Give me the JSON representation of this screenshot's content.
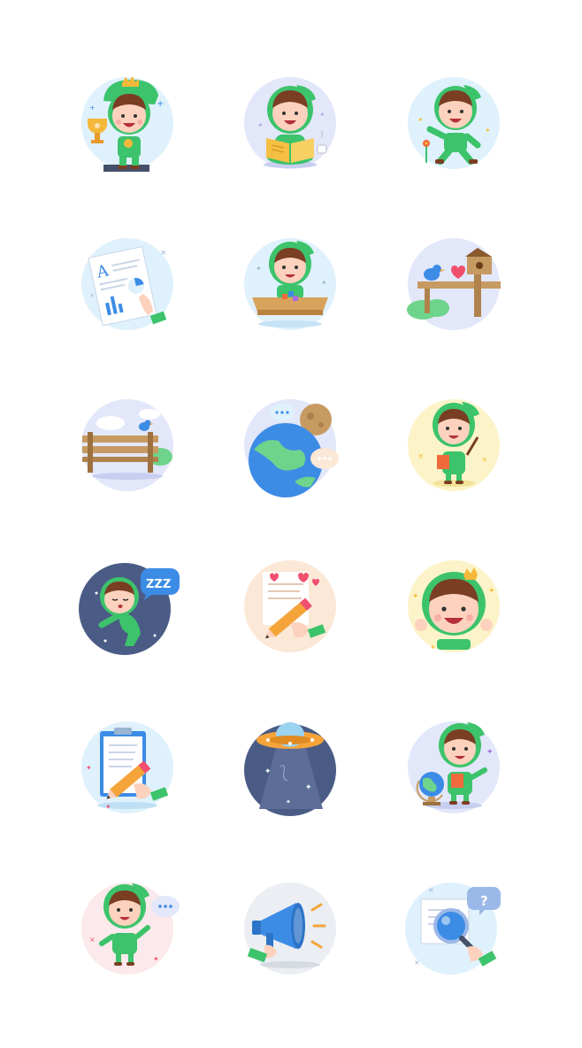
{
  "icons": [
    {
      "name": "kid-trophy-icon"
    },
    {
      "name": "kid-reading-book-icon"
    },
    {
      "name": "kid-walking-flower-icon"
    },
    {
      "name": "document-chart-icon",
      "text": {
        "letter": "A"
      }
    },
    {
      "name": "kid-desk-blocks-icon"
    },
    {
      "name": "bird-birdhouse-icon"
    },
    {
      "name": "park-bench-icon"
    },
    {
      "name": "earth-moon-chat-icon"
    },
    {
      "name": "kid-holding-book-icon"
    },
    {
      "name": "kid-sleeping-icon",
      "text": {
        "zzz": "ZZZ"
      }
    },
    {
      "name": "hand-writing-letter-icon"
    },
    {
      "name": "kid-crown-happy-icon"
    },
    {
      "name": "clipboard-pencil-icon"
    },
    {
      "name": "ufo-space-icon"
    },
    {
      "name": "kid-globe-icon"
    },
    {
      "name": "kid-chat-bubble-icon"
    },
    {
      "name": "megaphone-icon"
    },
    {
      "name": "magnifier-question-icon",
      "text": {
        "question": "?"
      }
    }
  ],
  "colors": {
    "skin": "#FCD2BE",
    "hair": "#7A3E22",
    "hood": "#3CC36B",
    "hood_dark": "#2BAE59",
    "mouth": "#B4303A",
    "bg_blue": "#DFF1FC",
    "bg_lilac": "#E3E7FA",
    "bg_yellow": "#FCF4C8",
    "bg_peach": "#FCE8D7",
    "bg_pink": "#FBE9EB",
    "bg_grey": "#EBEEF2",
    "night": "#4A5C86",
    "accent_blue": "#3C8CE6",
    "accent_orange": "#F5A43A",
    "heart": "#F0506E"
  }
}
